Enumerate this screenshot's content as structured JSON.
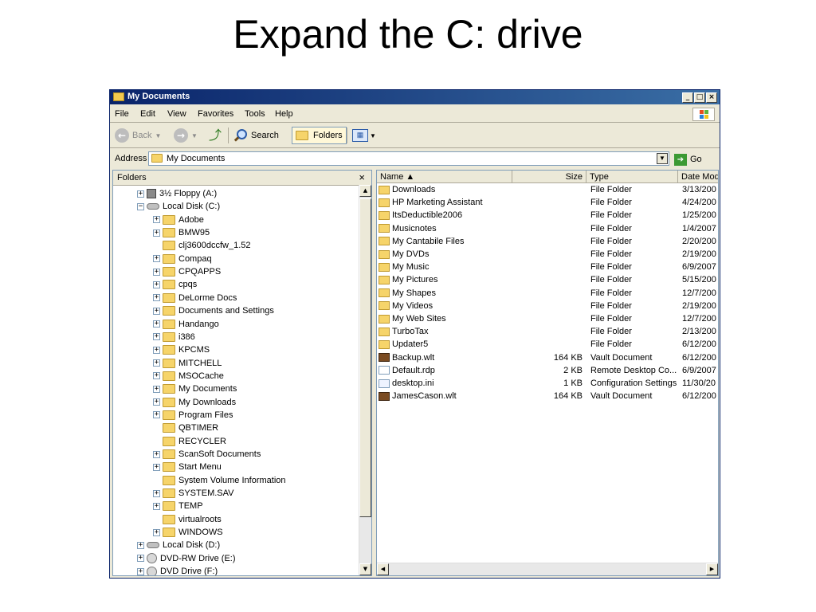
{
  "slide": {
    "title": "Expand the C: drive"
  },
  "window": {
    "title": "My Documents",
    "controls": {
      "minimize": "_",
      "maximize": "□",
      "close": "×"
    }
  },
  "menu": {
    "file": "File",
    "edit": "Edit",
    "view": "View",
    "favorites": "Favorites",
    "tools": "Tools",
    "help": "Help"
  },
  "toolbar": {
    "back": "Back",
    "search": "Search",
    "folders": "Folders"
  },
  "address": {
    "label": "Address",
    "value": "My Documents",
    "go": "Go"
  },
  "tree": {
    "header": "Folders",
    "items": [
      {
        "label": "3½ Floppy (A:)",
        "level": 0,
        "expander": "+",
        "icon": "floppy-icon"
      },
      {
        "label": "Local Disk (C:)",
        "level": 0,
        "expander": "−",
        "icon": "drive-icon"
      },
      {
        "label": "Adobe",
        "level": 1,
        "expander": "+",
        "icon": "folder-icon"
      },
      {
        "label": "BMW95",
        "level": 1,
        "expander": "+",
        "icon": "folder-icon"
      },
      {
        "label": "clj3600dccfw_1.52",
        "level": 1,
        "expander": "",
        "icon": "folder-icon"
      },
      {
        "label": "Compaq",
        "level": 1,
        "expander": "+",
        "icon": "folder-icon"
      },
      {
        "label": "CPQAPPS",
        "level": 1,
        "expander": "+",
        "icon": "folder-icon"
      },
      {
        "label": "cpqs",
        "level": 1,
        "expander": "+",
        "icon": "folder-icon"
      },
      {
        "label": "DeLorme Docs",
        "level": 1,
        "expander": "+",
        "icon": "folder-icon"
      },
      {
        "label": "Documents and Settings",
        "level": 1,
        "expander": "+",
        "icon": "folder-icon"
      },
      {
        "label": "Handango",
        "level": 1,
        "expander": "+",
        "icon": "folder-icon"
      },
      {
        "label": "i386",
        "level": 1,
        "expander": "+",
        "icon": "folder-icon"
      },
      {
        "label": "KPCMS",
        "level": 1,
        "expander": "+",
        "icon": "folder-icon"
      },
      {
        "label": "MITCHELL",
        "level": 1,
        "expander": "+",
        "icon": "folder-icon"
      },
      {
        "label": "MSOCache",
        "level": 1,
        "expander": "+",
        "icon": "folder-icon"
      },
      {
        "label": "My Documents",
        "level": 1,
        "expander": "+",
        "icon": "folder-icon"
      },
      {
        "label": "My Downloads",
        "level": 1,
        "expander": "+",
        "icon": "folder-icon"
      },
      {
        "label": "Program Files",
        "level": 1,
        "expander": "+",
        "icon": "folder-icon"
      },
      {
        "label": "QBTIMER",
        "level": 1,
        "expander": "",
        "icon": "folder-icon"
      },
      {
        "label": "RECYCLER",
        "level": 1,
        "expander": "",
        "icon": "folder-icon"
      },
      {
        "label": "ScanSoft Documents",
        "level": 1,
        "expander": "+",
        "icon": "folder-icon"
      },
      {
        "label": "Start Menu",
        "level": 1,
        "expander": "+",
        "icon": "folder-icon"
      },
      {
        "label": "System Volume Information",
        "level": 1,
        "expander": "",
        "icon": "folder-icon"
      },
      {
        "label": "SYSTEM.SAV",
        "level": 1,
        "expander": "+",
        "icon": "folder-icon"
      },
      {
        "label": "TEMP",
        "level": 1,
        "expander": "+",
        "icon": "folder-icon"
      },
      {
        "label": "virtualroots",
        "level": 1,
        "expander": "",
        "icon": "folder-icon"
      },
      {
        "label": "WINDOWS",
        "level": 1,
        "expander": "+",
        "icon": "folder-icon"
      },
      {
        "label": "Local Disk (D:)",
        "level": 0,
        "expander": "+",
        "icon": "drive-icon"
      },
      {
        "label": "DVD-RW Drive (E:)",
        "level": 0,
        "expander": "+",
        "icon": "cd-icon"
      },
      {
        "label": "DVD Drive (F:)",
        "level": 0,
        "expander": "+",
        "icon": "cd-icon"
      }
    ]
  },
  "list": {
    "columns": {
      "name": "Name ▲",
      "size": "Size",
      "type": "Type",
      "date": "Date Mod"
    },
    "rows": [
      {
        "name": "Downloads",
        "size": "",
        "type": "File Folder",
        "date": "3/13/200",
        "icon": "fi-folder"
      },
      {
        "name": "HP Marketing Assistant",
        "size": "",
        "type": "File Folder",
        "date": "4/24/200",
        "icon": "fi-folder"
      },
      {
        "name": "ItsDeductible2006",
        "size": "",
        "type": "File Folder",
        "date": "1/25/200",
        "icon": "fi-folder"
      },
      {
        "name": "Musicnotes",
        "size": "",
        "type": "File Folder",
        "date": "1/4/2007",
        "icon": "fi-folder"
      },
      {
        "name": "My Cantabile Files",
        "size": "",
        "type": "File Folder",
        "date": "2/20/200",
        "icon": "fi-folder"
      },
      {
        "name": "My DVDs",
        "size": "",
        "type": "File Folder",
        "date": "2/19/200",
        "icon": "fi-folder"
      },
      {
        "name": "My Music",
        "size": "",
        "type": "File Folder",
        "date": "6/9/2007",
        "icon": "fi-folder"
      },
      {
        "name": "My Pictures",
        "size": "",
        "type": "File Folder",
        "date": "5/15/200",
        "icon": "fi-folder"
      },
      {
        "name": "My Shapes",
        "size": "",
        "type": "File Folder",
        "date": "12/7/200",
        "icon": "fi-folder"
      },
      {
        "name": "My Videos",
        "size": "",
        "type": "File Folder",
        "date": "2/19/200",
        "icon": "fi-folder"
      },
      {
        "name": "My Web Sites",
        "size": "",
        "type": "File Folder",
        "date": "12/7/200",
        "icon": "fi-folder"
      },
      {
        "name": "TurboTax",
        "size": "",
        "type": "File Folder",
        "date": "2/13/200",
        "icon": "fi-folder"
      },
      {
        "name": "Updater5",
        "size": "",
        "type": "File Folder",
        "date": "6/12/200",
        "icon": "fi-folder"
      },
      {
        "name": "Backup.wlt",
        "size": "164 KB",
        "type": "Vault Document",
        "date": "6/12/200",
        "icon": "fi-vault"
      },
      {
        "name": "Default.rdp",
        "size": "2 KB",
        "type": "Remote Desktop Co...",
        "date": "6/9/2007",
        "icon": "fi-doc"
      },
      {
        "name": "desktop.ini",
        "size": "1 KB",
        "type": "Configuration Settings",
        "date": "11/30/20",
        "icon": "fi-config"
      },
      {
        "name": "JamesCason.wlt",
        "size": "164 KB",
        "type": "Vault Document",
        "date": "6/12/200",
        "icon": "fi-vault"
      }
    ]
  }
}
